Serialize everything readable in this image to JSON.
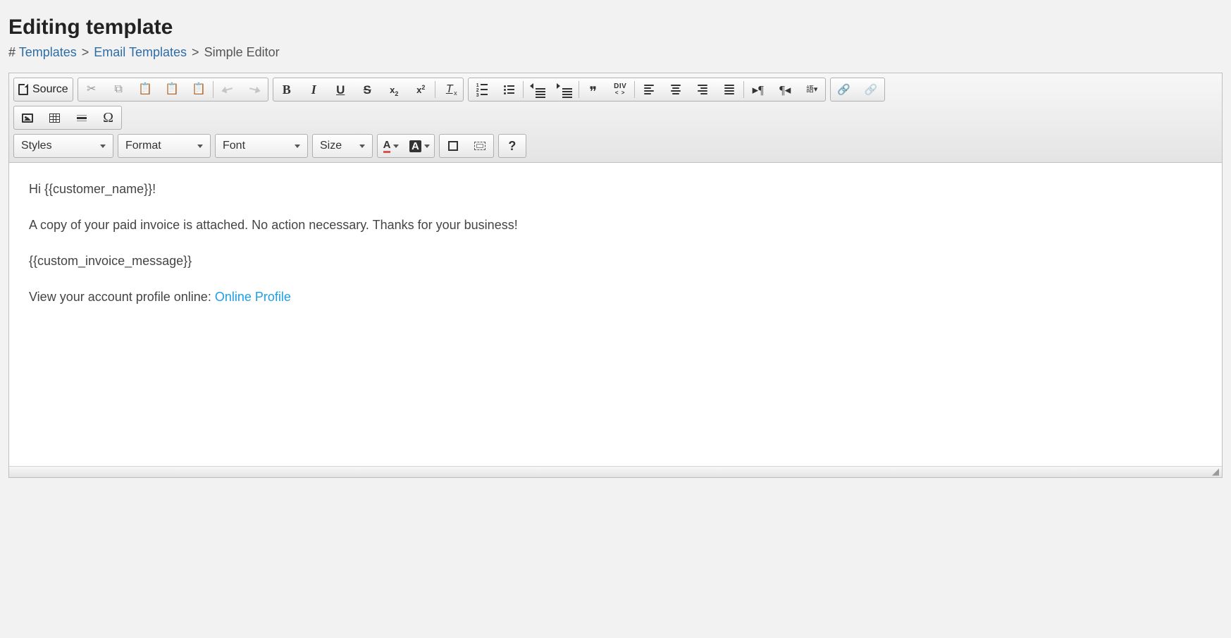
{
  "page": {
    "title": "Editing template"
  },
  "breadcrumb": {
    "hash": "#",
    "items": [
      "Templates",
      "Email Templates"
    ],
    "current": "Simple Editor",
    "sep": ">"
  },
  "toolbar": {
    "source_label": "Source",
    "combos": {
      "styles": "Styles",
      "format": "Format",
      "font": "Font",
      "size": "Size"
    },
    "text": {
      "bold": "B",
      "italic": "I",
      "underline": "U",
      "strike": "S",
      "subscript": "x",
      "superscript": "x",
      "removefmt": "T"
    },
    "quote": "❞",
    "div": "DIV",
    "divsub": "< >",
    "ltr": "▸¶",
    "rtl": "¶◂",
    "textcolor": "A",
    "bgcolor": "A",
    "help": "?",
    "omega": "Ω"
  },
  "content": {
    "p1": "Hi {{customer_name}}!",
    "p2": "A copy of your paid invoice is attached. No action necessary. Thanks for your business!",
    "p3": "{{custom_invoice_message}}",
    "p4_pre": "View your account profile online: ",
    "p4_link": "Online Profile"
  }
}
